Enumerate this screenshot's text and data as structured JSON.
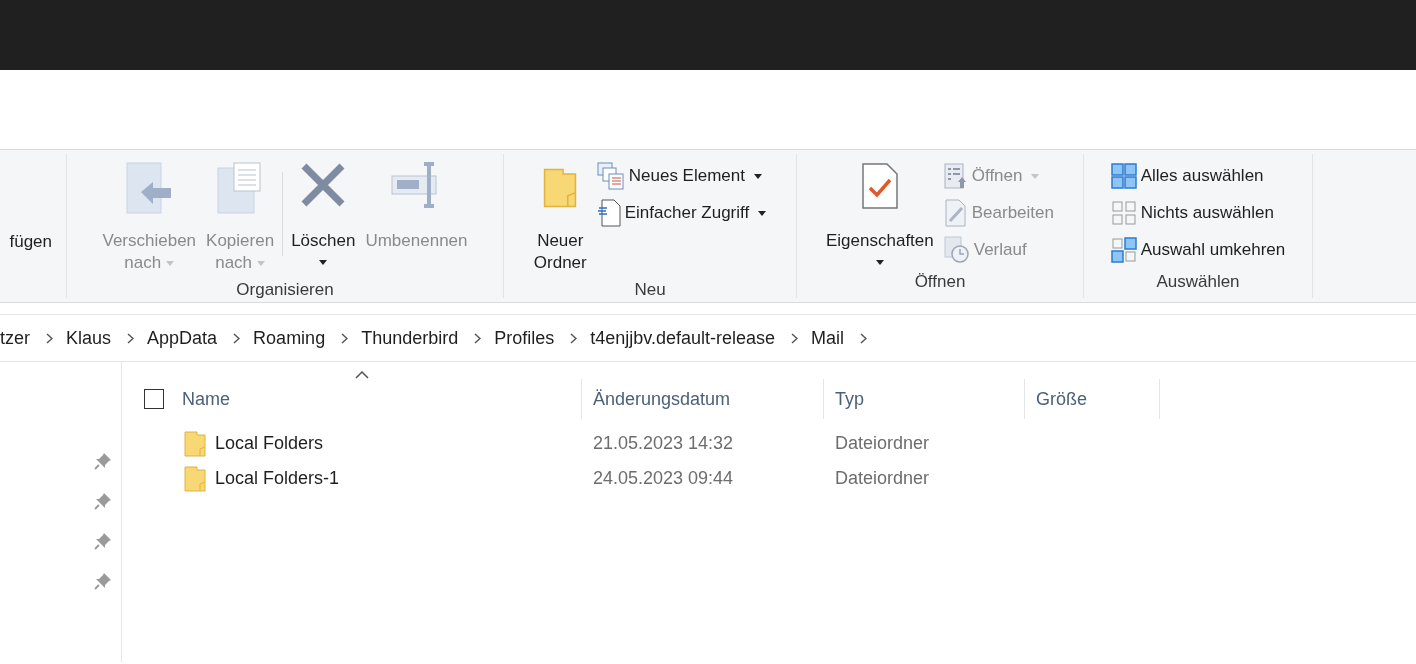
{
  "ribbon": {
    "groups": [
      {
        "buttons": [
          {
            "kind": "text",
            "label": "fügen",
            "disabled": false,
            "dropdown": false
          }
        ]
      },
      {
        "label": "Organisieren",
        "buttons": [
          {
            "kind": "large",
            "lines": [
              "Verschieben",
              "nach"
            ],
            "disabled": true,
            "dropdown": true
          },
          {
            "kind": "large",
            "lines": [
              "Kopieren",
              "nach"
            ],
            "disabled": true,
            "dropdown": true
          },
          {
            "kind": "large",
            "lines": [
              "Löschen"
            ],
            "disabled": false,
            "dropdown": true
          },
          {
            "kind": "large",
            "lines": [
              "Umbenennen"
            ],
            "disabled": true,
            "dropdown": false
          }
        ]
      },
      {
        "label": "Neu",
        "buttons": [
          {
            "kind": "large",
            "lines": [
              "Neuer",
              "Ordner"
            ],
            "disabled": false,
            "dropdown": false
          },
          {
            "kind": "small",
            "label": "Neues Element",
            "disabled": false,
            "dropdown": true
          },
          {
            "kind": "small",
            "label": "Einfacher Zugriff",
            "disabled": false,
            "dropdown": true
          }
        ]
      },
      {
        "label": "Öffnen",
        "buttons": [
          {
            "kind": "large",
            "lines": [
              "Eigenschaften"
            ],
            "disabled": false,
            "dropdown": true
          },
          {
            "kind": "small",
            "label": "Öffnen",
            "disabled": true,
            "dropdown": true
          },
          {
            "kind": "small",
            "label": "Bearbeiten",
            "disabled": true,
            "dropdown": false
          },
          {
            "kind": "small",
            "label": "Verlauf",
            "disabled": true,
            "dropdown": false
          }
        ]
      },
      {
        "label": "Auswählen",
        "buttons": [
          {
            "kind": "small",
            "label": "Alles auswählen",
            "disabled": false,
            "dropdown": false
          },
          {
            "kind": "small",
            "label": "Nichts auswählen",
            "disabled": false,
            "dropdown": false
          },
          {
            "kind": "small",
            "label": "Auswahl umkehren",
            "disabled": false,
            "dropdown": false
          }
        ]
      }
    ]
  },
  "breadcrumb": [
    "tzer",
    "Klaus",
    "AppData",
    "Roaming",
    "Thunderbird",
    "Profiles",
    "t4enjjbv.default-release",
    "Mail"
  ],
  "table": {
    "select_all": {
      "checked": false
    },
    "columns": [
      {
        "label": "Name",
        "sorted": true
      },
      {
        "label": "Änderungsdatum",
        "sorted": false
      },
      {
        "label": "Typ",
        "sorted": false
      },
      {
        "label": "Größe",
        "sorted": false
      }
    ],
    "rows": [
      {
        "name": "Local Folders",
        "modified": "21.05.2023 14:32",
        "type": "Dateiordner"
      },
      {
        "name": "Local Folders-1",
        "modified": "24.05.2023 09:44",
        "type": "Dateiordner"
      }
    ]
  }
}
